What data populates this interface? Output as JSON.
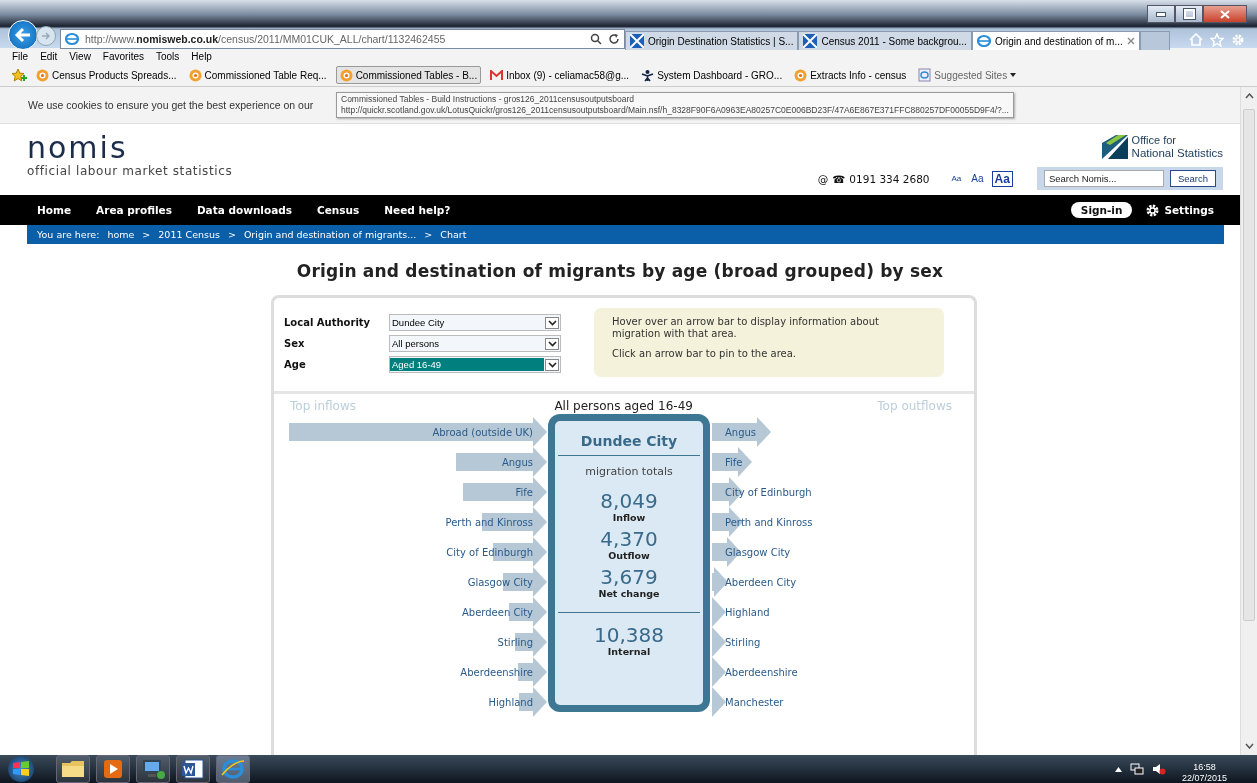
{
  "browser": {
    "address_prefix": "http://www.",
    "address_host": "nomisweb.co.uk",
    "address_path": "/census/2011/MM01CUK_ALL/chart/1132462455",
    "tabs": [
      {
        "label": "Origin Destination Statistics | S...",
        "kind": "flag",
        "selected": false
      },
      {
        "label": "Census 2011 - Some backgrou...",
        "kind": "flag",
        "selected": false
      },
      {
        "label": "Origin and destination of m...",
        "kind": "ie",
        "selected": true
      }
    ],
    "menu": [
      "File",
      "Edit",
      "View",
      "Favorites",
      "Tools",
      "Help"
    ],
    "favorites": [
      {
        "label": "Census Products Spreads...",
        "kind": "quickr",
        "selected": false
      },
      {
        "label": "Commissioned Table Req...",
        "kind": "quickr",
        "selected": false
      },
      {
        "label": "Commissioned Tables - B...",
        "kind": "quickr",
        "selected": true
      },
      {
        "label": "Inbox (9) - celiamac58@g...",
        "kind": "mail",
        "selected": false
      },
      {
        "label": "System Dashboard - GRO...",
        "kind": "dashboard",
        "selected": false
      },
      {
        "label": "Extracts Info - census",
        "kind": "quickr",
        "selected": false
      },
      {
        "label": "Suggested Sites",
        "kind": "suggested",
        "selected": false
      }
    ],
    "tooltip": [
      "Commissioned Tables - Build Instructions - gros126_2011censusoutputsboard",
      "http://quickr.scotland.gov.uk/LotusQuickr/gros126_2011censusoutputsboard/Main.nsf/h_8328F90F6A0963EA80257C0E006BD23F/47A6E867E371FFC880257DF00055D9F4/?..."
    ]
  },
  "cookie_notice": "We use cookies to ensure you get the best experience on our",
  "site": {
    "logo": "nomis",
    "tagline": "official labour market statistics",
    "ons": [
      "Office for",
      "National Statistics"
    ],
    "contact_icons": [
      "@",
      "☎"
    ],
    "phone": "0191 334 2680",
    "text_sizes": [
      {
        "label": "Aa",
        "selected": false
      },
      {
        "label": "Aa",
        "selected": false
      },
      {
        "label": "Aa",
        "selected": true
      }
    ],
    "search": {
      "placeholder": "Search Nomis...",
      "button": "Search"
    },
    "nav": [
      "Home",
      "Area profiles",
      "Data downloads",
      "Census",
      "Need help?"
    ],
    "sign_in": "Sign-in",
    "settings": "Settings",
    "breadcrumb": {
      "lead": "You are here:",
      "separator": ">",
      "items": [
        "home",
        "2011 Census",
        "Origin and destination of migrants...",
        "Chart"
      ]
    }
  },
  "title": "Origin and destination of migrants by age (broad grouped) by sex",
  "form": [
    {
      "label": "Local Authority",
      "value": "Dundee City",
      "selected": false
    },
    {
      "label": "Sex",
      "value": "All persons",
      "selected": false
    },
    {
      "label": "Age",
      "value": "Aged 16-49",
      "selected": true
    }
  ],
  "info": [
    "Hover over an arrow bar to display information about migration with that area.",
    "Click an arrow bar to pin to the area."
  ],
  "chart": {
    "inflows_heading": "Top inflows",
    "subtitle": "All persons aged 16-49",
    "outflows_heading": "Top outflows",
    "area": "Dundee City",
    "totals_heading": "migration totals",
    "stats": [
      {
        "value": "8,049",
        "label": "Inflow"
      },
      {
        "value": "4,370",
        "label": "Outflow"
      },
      {
        "value": "3,679",
        "label": "Net change"
      }
    ],
    "internal": {
      "value": "10,388",
      "label": "Internal"
    },
    "inflows": [
      {
        "name": "Abroad (outside UK)"
      },
      {
        "name": "Angus"
      },
      {
        "name": "Fife"
      },
      {
        "name": "Perth and Kinross"
      },
      {
        "name": "City of Edinburgh"
      },
      {
        "name": "Glasgow City"
      },
      {
        "name": "Aberdeen City"
      },
      {
        "name": "Stirling"
      },
      {
        "name": "Aberdeenshire"
      },
      {
        "name": "Highland"
      }
    ],
    "outflows": [
      {
        "name": "Angus"
      },
      {
        "name": "Fife"
      },
      {
        "name": "City of Edinburgh"
      },
      {
        "name": "Perth and Kinross"
      },
      {
        "name": "Glasgow City"
      },
      {
        "name": "Aberdeen City"
      },
      {
        "name": "Highland"
      },
      {
        "name": "Stirling"
      },
      {
        "name": "Aberdeenshire"
      },
      {
        "name": "Manchester"
      }
    ]
  },
  "taskbar": {
    "time": "16:58",
    "date": "22/07/2015"
  }
}
